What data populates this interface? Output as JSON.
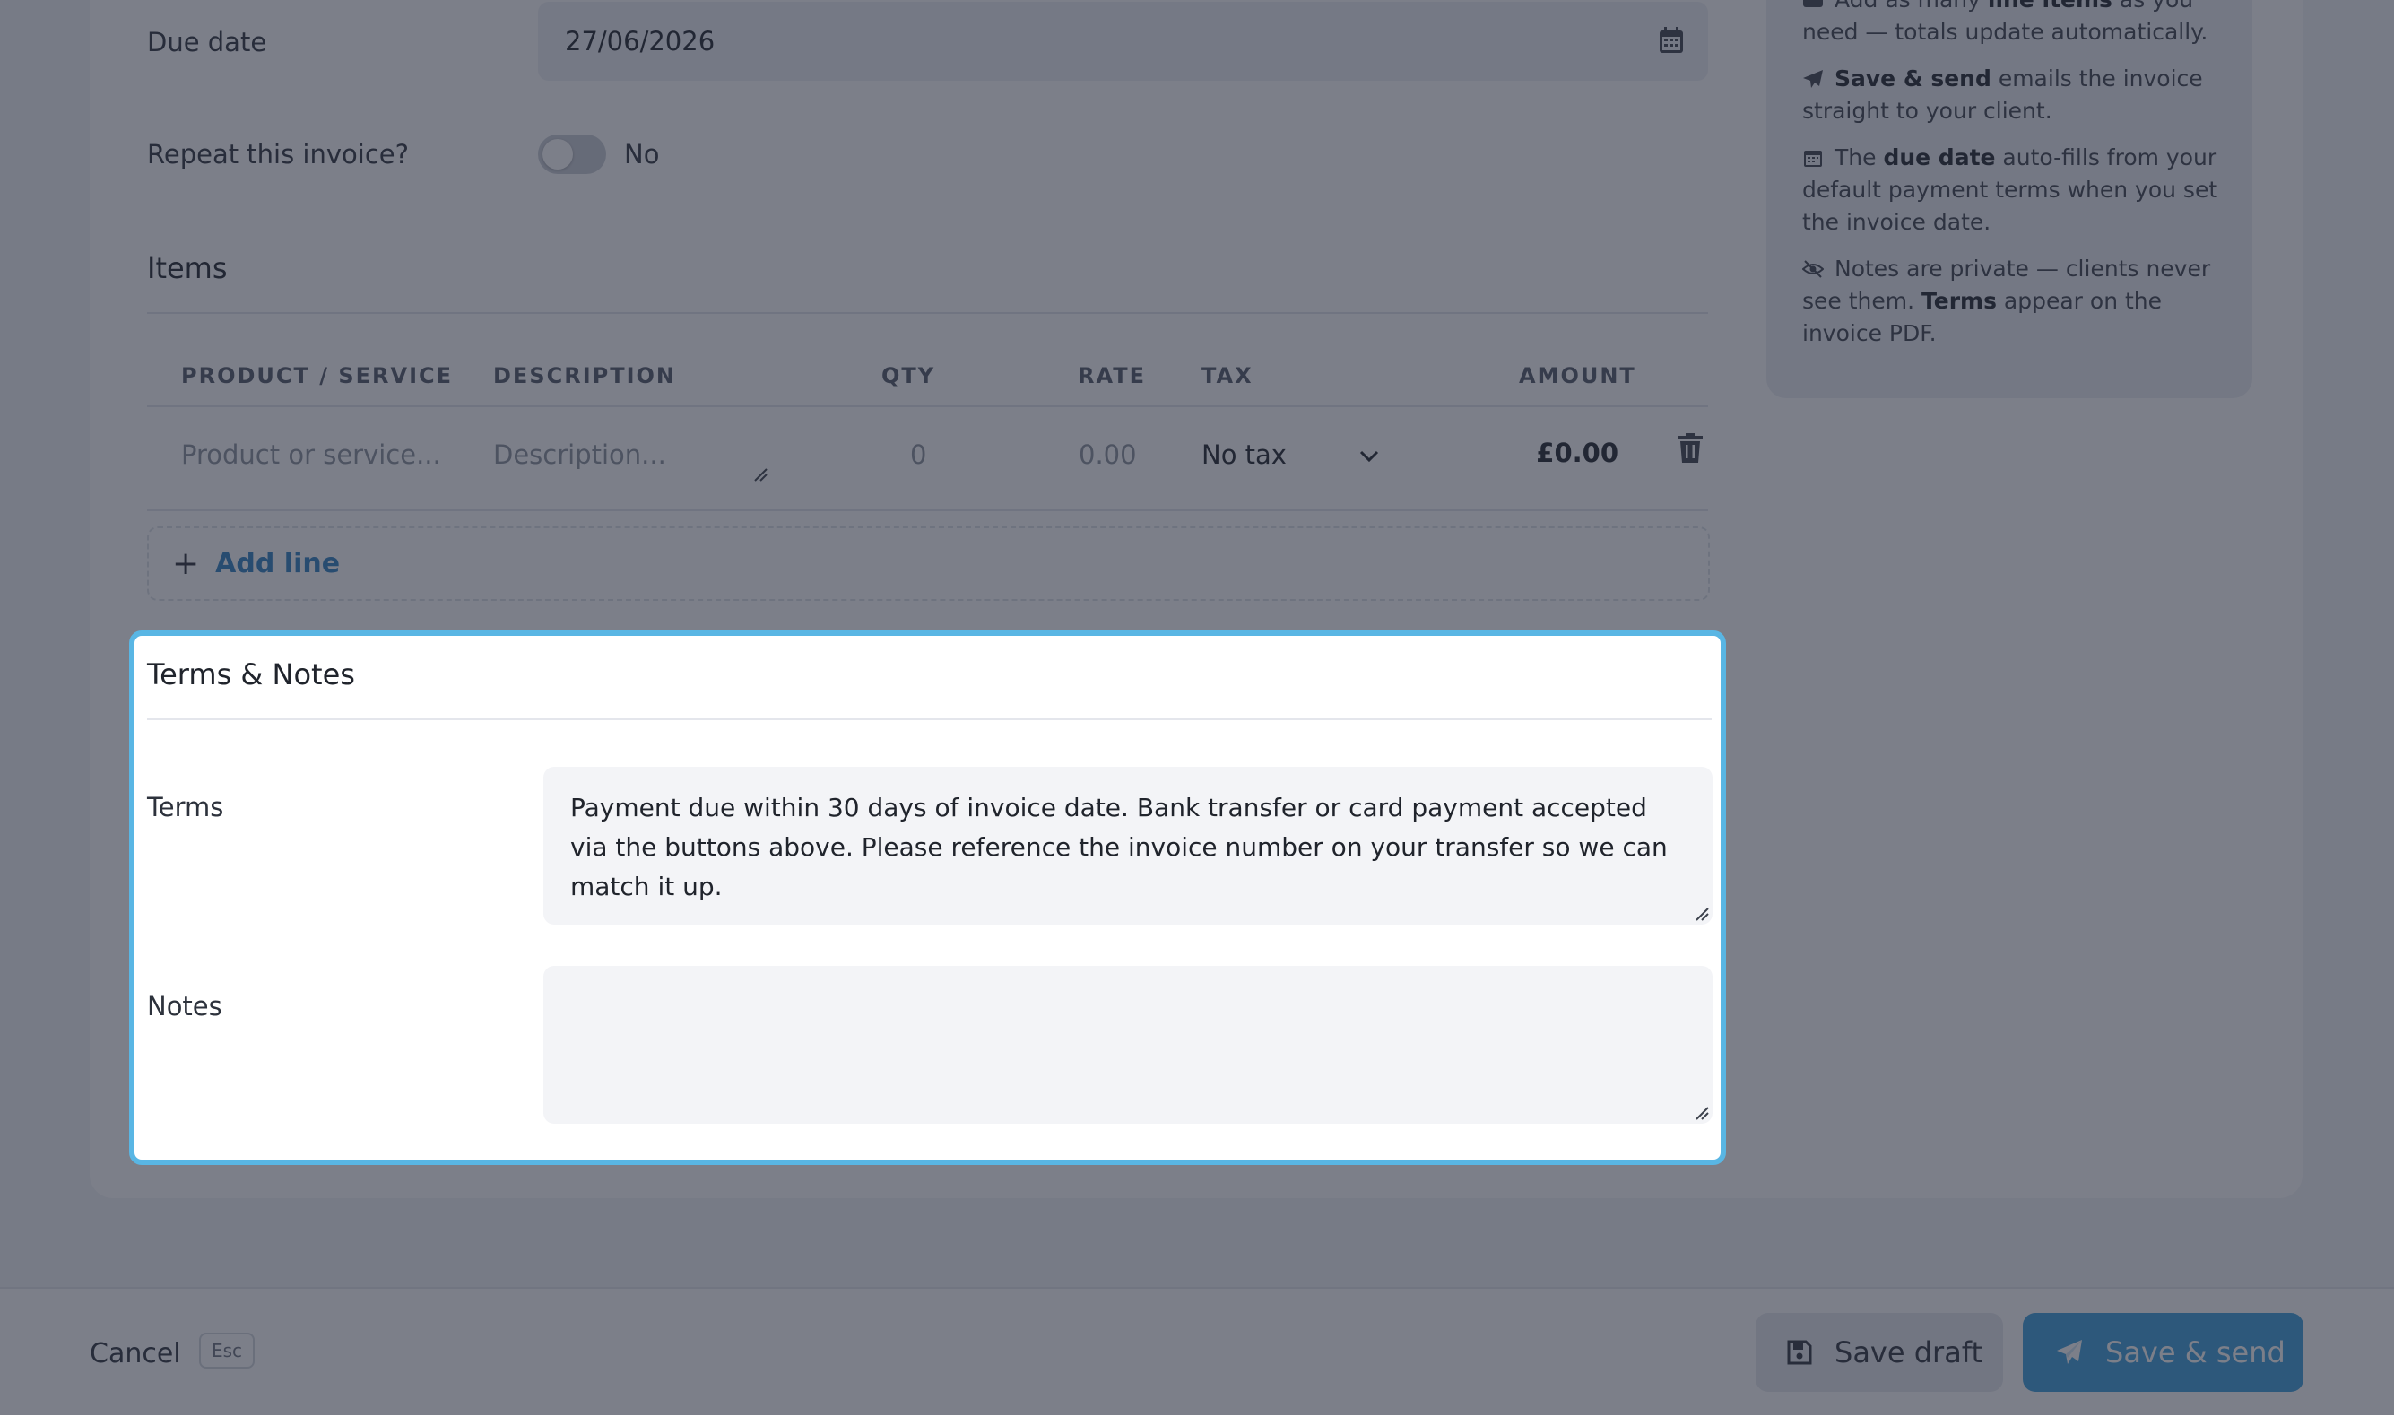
{
  "form": {
    "due_date_label": "Due date",
    "due_date_value": "27/06/2026",
    "repeat_label": "Repeat this invoice?",
    "repeat_value": "No",
    "items_title": "Items"
  },
  "table": {
    "headers": [
      "PRODUCT / SERVICE",
      "DESCRIPTION",
      "QTY",
      "RATE",
      "TAX",
      "AMOUNT"
    ],
    "row": {
      "product_placeholder": "Product or service...",
      "description_placeholder": "Description...",
      "qty_placeholder": "0",
      "rate_placeholder": "0.00",
      "tax": "No tax",
      "amount": "£0.00"
    },
    "add_line_label": "Add line"
  },
  "tips": [
    {
      "icon": "list-icon",
      "parts": [
        [
          "Add as many ",
          false
        ],
        [
          "line items",
          true
        ],
        [
          " as you need — totals update automatically.",
          false
        ]
      ]
    },
    {
      "icon": "paper-plane-icon",
      "parts": [
        [
          "Save & send",
          true
        ],
        [
          " emails the invoice straight to your client.",
          false
        ]
      ]
    },
    {
      "icon": "calendar-icon",
      "parts": [
        [
          "The ",
          false
        ],
        [
          "due date",
          true
        ],
        [
          " auto-fills from your default payment terms when you set the invoice date.",
          false
        ]
      ]
    },
    {
      "icon": "eye-slash-icon",
      "parts": [
        [
          "Notes are private — clients never see them. ",
          false
        ],
        [
          "Terms",
          true
        ],
        [
          " appear on the invoice PDF.",
          false
        ]
      ]
    }
  ],
  "terms_notes": {
    "title": "Terms & Notes",
    "terms_label": "Terms",
    "terms_value": "Payment due within 30 days of invoice date. Bank transfer or card payment accepted via the buttons above. Please reference the invoice number on your transfer so we can match it up.",
    "notes_label": "Notes",
    "notes_value": ""
  },
  "footer": {
    "cancel_label": "Cancel",
    "esc_hint": "Esc",
    "save_draft_label": "Save draft",
    "save_send_label": "Save & send"
  },
  "colors": {
    "accent": "#3b9edb",
    "link": "#2f7fc1",
    "highlight_border": "#59b6e4",
    "overlay": "#242a3a"
  }
}
